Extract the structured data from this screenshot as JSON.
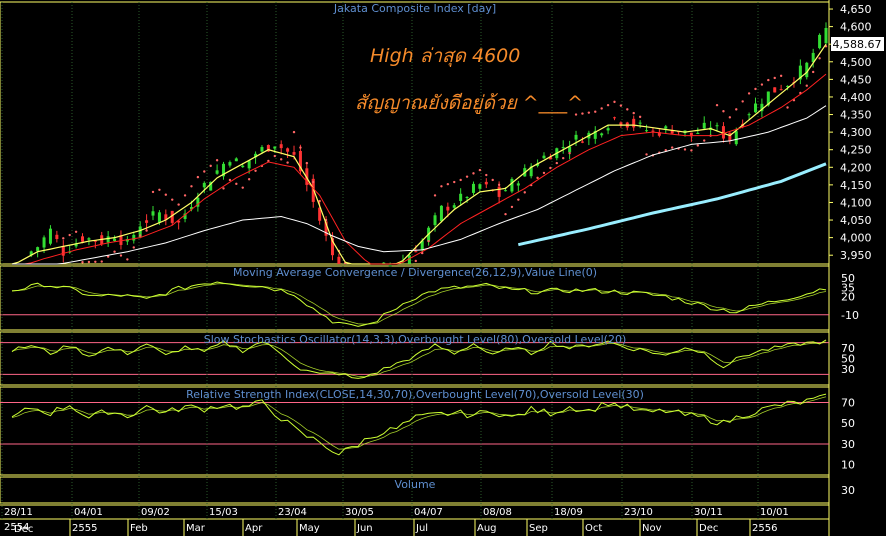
{
  "colors": {
    "background": "#000000",
    "border": "#ffff66",
    "grid": "#2a5a2a",
    "bull": "#33dd33",
    "bear": "#ff3333",
    "ema_fast": "#ffff66",
    "ema_mid": "#ff2222",
    "ma_slow": "#ffffff",
    "trend": "#99eeff",
    "sar": "#ff6666",
    "osc": "#ccff33",
    "level": "#ff6688",
    "title": "#5f8fd0",
    "annotation": "#f58a2a",
    "last_price_bg": "#ffffff"
  },
  "main": {
    "title": "Jakata Composite Index [day]",
    "last_price": "4,588.67",
    "annotation_line1": "High ล่าสุด 4600",
    "annotation_line2": "สัญญาณยังดีอยู่ด้วย ^___^",
    "y_ticks": [
      "4,650",
      "4,600",
      "4,550",
      "4,500",
      "4,450",
      "4,400",
      "4,350",
      "4,300",
      "4,250",
      "4,200",
      "4,150",
      "4,100",
      "4,050",
      "4,000",
      "3,950"
    ]
  },
  "macd": {
    "title": "Moving Average Convergence / Divergence(26,12,9),Value Line(0)",
    "y_ticks": [
      "50",
      "35",
      "20",
      "-10"
    ]
  },
  "stoch": {
    "title": "Slow Stochastics Oscillator(14,3,3),Overbought Level(80),Oversold Level(20)",
    "y_ticks": [
      "70",
      "50",
      "30"
    ]
  },
  "rsi": {
    "title": "Relative Strength Index(CLOSE,14,30,70),Overbought Level(70),Oversold Level(30)",
    "y_ticks": [
      "70",
      "50",
      "30",
      "10"
    ]
  },
  "volume": {
    "title": "Volume",
    "y_ticks": [
      "30"
    ]
  },
  "x_axis": {
    "dates": [
      "28/11",
      "04/01",
      "09/02",
      "15/03",
      "23/04",
      "30/05",
      "04/07",
      "08/08",
      "18/09",
      "23/10",
      "30/11",
      "10/01"
    ],
    "months": [
      "2555",
      "Feb",
      "Mar",
      "Apr",
      "May",
      "Jun",
      "Jul",
      "Aug",
      "Sep",
      "Oct",
      "Nov",
      "Dec",
      "2556"
    ],
    "corner_top": "2554",
    "corner_bottom": "Dec"
  },
  "chart_data": {
    "type": "candlestick",
    "title": "Jakata Composite Index [day]",
    "ylim": [
      3925,
      4670
    ],
    "date_range": [
      "28/11/2554",
      "11/01/2556"
    ],
    "close_path": [
      [
        0,
        3920
      ],
      [
        4,
        3975
      ],
      [
        6,
        4020
      ],
      [
        8,
        3960
      ],
      [
        11,
        4000
      ],
      [
        14,
        3990
      ],
      [
        16,
        4010
      ],
      [
        18,
        3980
      ],
      [
        20,
        4040
      ],
      [
        23,
        4070
      ],
      [
        26,
        4040
      ],
      [
        29,
        4130
      ],
      [
        32,
        4190
      ],
      [
        34,
        4230
      ],
      [
        36,
        4200
      ],
      [
        38,
        4240
      ],
      [
        41,
        4270
      ],
      [
        44,
        4230
      ],
      [
        46,
        4150
      ],
      [
        48,
        4050
      ],
      [
        50,
        3950
      ],
      [
        52,
        3890
      ],
      [
        55,
        3870
      ],
      [
        58,
        3915
      ],
      [
        61,
        3935
      ],
      [
        64,
        3990
      ],
      [
        67,
        4080
      ],
      [
        70,
        4110
      ],
      [
        73,
        4150
      ],
      [
        76,
        4120
      ],
      [
        79,
        4170
      ],
      [
        82,
        4220
      ],
      [
        85,
        4250
      ],
      [
        88,
        4280
      ],
      [
        91,
        4300
      ],
      [
        94,
        4340
      ],
      [
        97,
        4320
      ],
      [
        100,
        4300
      ],
      [
        103,
        4310
      ],
      [
        106,
        4290
      ],
      [
        109,
        4320
      ],
      [
        112,
        4280
      ],
      [
        115,
        4360
      ],
      [
        118,
        4410
      ],
      [
        121,
        4440
      ],
      [
        124,
        4490
      ],
      [
        126,
        4560
      ],
      [
        127,
        4590
      ]
    ],
    "series": [
      {
        "name": "EMA fast",
        "type": "line",
        "path": [
          [
            0,
            3920
          ],
          [
            4,
            3960
          ],
          [
            8,
            3975
          ],
          [
            12,
            3990
          ],
          [
            16,
            4000
          ],
          [
            20,
            4020
          ],
          [
            24,
            4050
          ],
          [
            28,
            4100
          ],
          [
            32,
            4170
          ],
          [
            36,
            4210
          ],
          [
            40,
            4250
          ],
          [
            44,
            4230
          ],
          [
            47,
            4140
          ],
          [
            50,
            3990
          ],
          [
            53,
            3900
          ],
          [
            57,
            3900
          ],
          [
            61,
            3935
          ],
          [
            65,
            4010
          ],
          [
            69,
            4080
          ],
          [
            73,
            4130
          ],
          [
            77,
            4140
          ],
          [
            81,
            4200
          ],
          [
            85,
            4240
          ],
          [
            89,
            4280
          ],
          [
            93,
            4320
          ],
          [
            97,
            4320
          ],
          [
            101,
            4310
          ],
          [
            105,
            4300
          ],
          [
            109,
            4310
          ],
          [
            112,
            4290
          ],
          [
            116,
            4350
          ],
          [
            120,
            4410
          ],
          [
            124,
            4470
          ],
          [
            127,
            4550
          ]
        ]
      },
      {
        "name": "EMA mid",
        "type": "line",
        "path": [
          [
            0,
            3910
          ],
          [
            5,
            3940
          ],
          [
            10,
            3965
          ],
          [
            15,
            3985
          ],
          [
            20,
            4000
          ],
          [
            25,
            4035
          ],
          [
            30,
            4110
          ],
          [
            35,
            4170
          ],
          [
            40,
            4215
          ],
          [
            44,
            4200
          ],
          [
            48,
            4120
          ],
          [
            52,
            3990
          ],
          [
            56,
            3920
          ],
          [
            60,
            3920
          ],
          [
            65,
            3970
          ],
          [
            70,
            4040
          ],
          [
            75,
            4090
          ],
          [
            80,
            4140
          ],
          [
            85,
            4200
          ],
          [
            90,
            4250
          ],
          [
            95,
            4290
          ],
          [
            100,
            4300
          ],
          [
            105,
            4290
          ],
          [
            110,
            4290
          ],
          [
            115,
            4320
          ],
          [
            120,
            4370
          ],
          [
            124,
            4420
          ],
          [
            127,
            4465
          ]
        ]
      },
      {
        "name": "MA slow",
        "type": "line",
        "path": [
          [
            0,
            3900
          ],
          [
            6,
            3920
          ],
          [
            12,
            3940
          ],
          [
            18,
            3960
          ],
          [
            24,
            3985
          ],
          [
            30,
            4020
          ],
          [
            36,
            4050
          ],
          [
            42,
            4060
          ],
          [
            46,
            4040
          ],
          [
            50,
            4005
          ],
          [
            54,
            3975
          ],
          [
            58,
            3960
          ],
          [
            64,
            3965
          ],
          [
            70,
            3995
          ],
          [
            76,
            4040
          ],
          [
            82,
            4080
          ],
          [
            88,
            4135
          ],
          [
            94,
            4190
          ],
          [
            100,
            4235
          ],
          [
            106,
            4265
          ],
          [
            112,
            4275
          ],
          [
            118,
            4300
          ],
          [
            124,
            4340
          ],
          [
            127,
            4375
          ]
        ]
      },
      {
        "name": "Trend",
        "type": "line",
        "path": [
          [
            79,
            3980
          ],
          [
            90,
            4025
          ],
          [
            100,
            4070
          ],
          [
            110,
            4110
          ],
          [
            120,
            4160
          ],
          [
            127,
            4210
          ]
        ]
      }
    ],
    "panels": [
      {
        "name": "MACD",
        "ylim": [
          -35,
          70
        ],
        "levels": [
          -10
        ],
        "path": [
          [
            0,
            30
          ],
          [
            5,
            40
          ],
          [
            9,
            32
          ],
          [
            13,
            20
          ],
          [
            17,
            22
          ],
          [
            21,
            15
          ],
          [
            25,
            30
          ],
          [
            29,
            40
          ],
          [
            32,
            45
          ],
          [
            36,
            40
          ],
          [
            40,
            35
          ],
          [
            44,
            25
          ],
          [
            47,
            0
          ],
          [
            50,
            -20
          ],
          [
            53,
            -30
          ],
          [
            56,
            -25
          ],
          [
            59,
            -5
          ],
          [
            62,
            15
          ],
          [
            66,
            30
          ],
          [
            70,
            35
          ],
          [
            74,
            38
          ],
          [
            78,
            30
          ],
          [
            82,
            28
          ],
          [
            86,
            30
          ],
          [
            90,
            30
          ],
          [
            94,
            28
          ],
          [
            98,
            25
          ],
          [
            102,
            20
          ],
          [
            106,
            10
          ],
          [
            110,
            0
          ],
          [
            113,
            -5
          ],
          [
            116,
            5
          ],
          [
            120,
            15
          ],
          [
            124,
            25
          ],
          [
            127,
            35
          ]
        ]
      },
      {
        "name": "Slow Stochastics",
        "ylim": [
          0,
          100
        ],
        "levels": [
          80,
          20
        ],
        "path": [
          [
            0,
            65
          ],
          [
            3,
            75
          ],
          [
            6,
            60
          ],
          [
            9,
            75
          ],
          [
            12,
            55
          ],
          [
            15,
            70
          ],
          [
            18,
            60
          ],
          [
            21,
            78
          ],
          [
            24,
            55
          ],
          [
            27,
            72
          ],
          [
            30,
            62
          ],
          [
            33,
            80
          ],
          [
            36,
            65
          ],
          [
            39,
            82
          ],
          [
            42,
            60
          ],
          [
            45,
            30
          ],
          [
            48,
            20
          ],
          [
            51,
            22
          ],
          [
            54,
            10
          ],
          [
            57,
            25
          ],
          [
            60,
            40
          ],
          [
            63,
            55
          ],
          [
            66,
            75
          ],
          [
            69,
            60
          ],
          [
            72,
            78
          ],
          [
            75,
            55
          ],
          [
            78,
            72
          ],
          [
            81,
            60
          ],
          [
            84,
            80
          ],
          [
            87,
            70
          ],
          [
            90,
            75
          ],
          [
            93,
            82
          ],
          [
            96,
            70
          ],
          [
            99,
            65
          ],
          [
            102,
            55
          ],
          [
            105,
            72
          ],
          [
            108,
            60
          ],
          [
            111,
            35
          ],
          [
            114,
            55
          ],
          [
            117,
            65
          ],
          [
            120,
            72
          ],
          [
            123,
            78
          ],
          [
            127,
            82
          ]
        ]
      },
      {
        "name": "RSI",
        "ylim": [
          0,
          85
        ],
        "levels": [
          70,
          30
        ],
        "path": [
          [
            0,
            55
          ],
          [
            3,
            65
          ],
          [
            6,
            60
          ],
          [
            9,
            68
          ],
          [
            12,
            55
          ],
          [
            15,
            62
          ],
          [
            18,
            57
          ],
          [
            21,
            66
          ],
          [
            24,
            60
          ],
          [
            27,
            66
          ],
          [
            30,
            64
          ],
          [
            33,
            68
          ],
          [
            36,
            65
          ],
          [
            39,
            70
          ],
          [
            42,
            55
          ],
          [
            45,
            40
          ],
          [
            48,
            32
          ],
          [
            51,
            20
          ],
          [
            54,
            30
          ],
          [
            57,
            40
          ],
          [
            60,
            45
          ],
          [
            63,
            55
          ],
          [
            66,
            58
          ],
          [
            69,
            60
          ],
          [
            72,
            58
          ],
          [
            75,
            62
          ],
          [
            78,
            55
          ],
          [
            81,
            63
          ],
          [
            84,
            60
          ],
          [
            87,
            66
          ],
          [
            90,
            62
          ],
          [
            93,
            70
          ],
          [
            96,
            65
          ],
          [
            99,
            60
          ],
          [
            102,
            62
          ],
          [
            105,
            58
          ],
          [
            108,
            55
          ],
          [
            111,
            50
          ],
          [
            114,
            58
          ],
          [
            117,
            63
          ],
          [
            120,
            68
          ],
          [
            123,
            70
          ],
          [
            127,
            75
          ]
        ]
      },
      {
        "name": "Volume",
        "ylim": [
          0,
          60
        ],
        "path": []
      }
    ]
  }
}
